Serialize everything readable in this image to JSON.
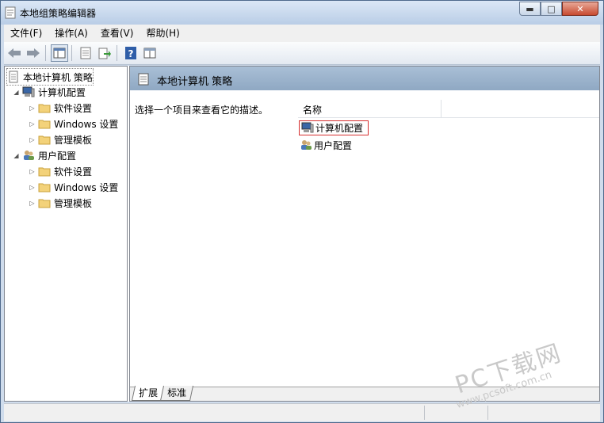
{
  "window": {
    "title": "本地组策略编辑器"
  },
  "controls": {
    "minimize": "▬",
    "maximize": "□",
    "close": "✕"
  },
  "menu": [
    {
      "label": "文件(F)"
    },
    {
      "label": "操作(A)"
    },
    {
      "label": "查看(V)"
    },
    {
      "label": "帮助(H)"
    }
  ],
  "toolbar": [
    "back-icon",
    "forward-icon",
    "console-tree-icon",
    "properties-icon",
    "export-icon",
    "help-icon",
    "view-icon"
  ],
  "tree": {
    "root": "本地计算机 策略",
    "computer": "计算机配置",
    "computer_children": [
      "软件设置",
      "Windows 设置",
      "管理模板"
    ],
    "user": "用户配置",
    "user_children": [
      "软件设置",
      "Windows 设置",
      "管理模板"
    ]
  },
  "panel": {
    "header": "本地计算机 策略",
    "description": "选择一个项目来查看它的描述。",
    "column_name": "名称",
    "items": [
      "计算机配置",
      "用户配置"
    ]
  },
  "tabs": [
    "扩展",
    "标准"
  ],
  "watermark": {
    "big": "PC下载网",
    "small": "www.pcsoft.com.cn"
  },
  "colors": {
    "selection_outline": "#d62f2f",
    "header_bg": "#9db4cd"
  }
}
